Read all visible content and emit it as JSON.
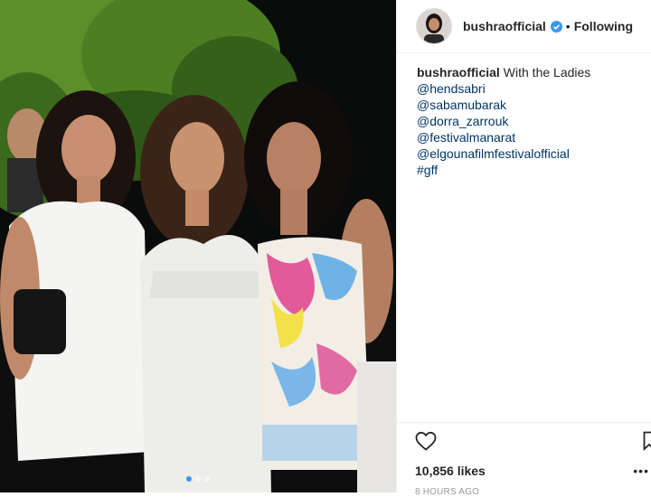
{
  "post": {
    "username": "bushraofficial",
    "separator": "•",
    "follow_status": "Following",
    "caption_user": "bushraofficial",
    "caption_text": "With the Ladies",
    "mentions": [
      "@hendsabri",
      "@sabamubarak",
      "@dorra_zarrouk",
      "@festivalmanarat",
      "@elgounafilmfestivalofficial",
      "#gff"
    ],
    "likes": "10,856 likes",
    "time": "8 HOURS AGO",
    "carousel": {
      "count": 3,
      "active_index": 0
    }
  },
  "icons": {
    "verified": "verified-badge-icon",
    "like": "heart-icon",
    "bookmark": "bookmark-icon",
    "more": "more-options-icon"
  },
  "colors": {
    "verified_blue": "#3897f0",
    "mention_blue": "#003569",
    "timestamp_gray": "#999999",
    "border": "#efefef"
  }
}
